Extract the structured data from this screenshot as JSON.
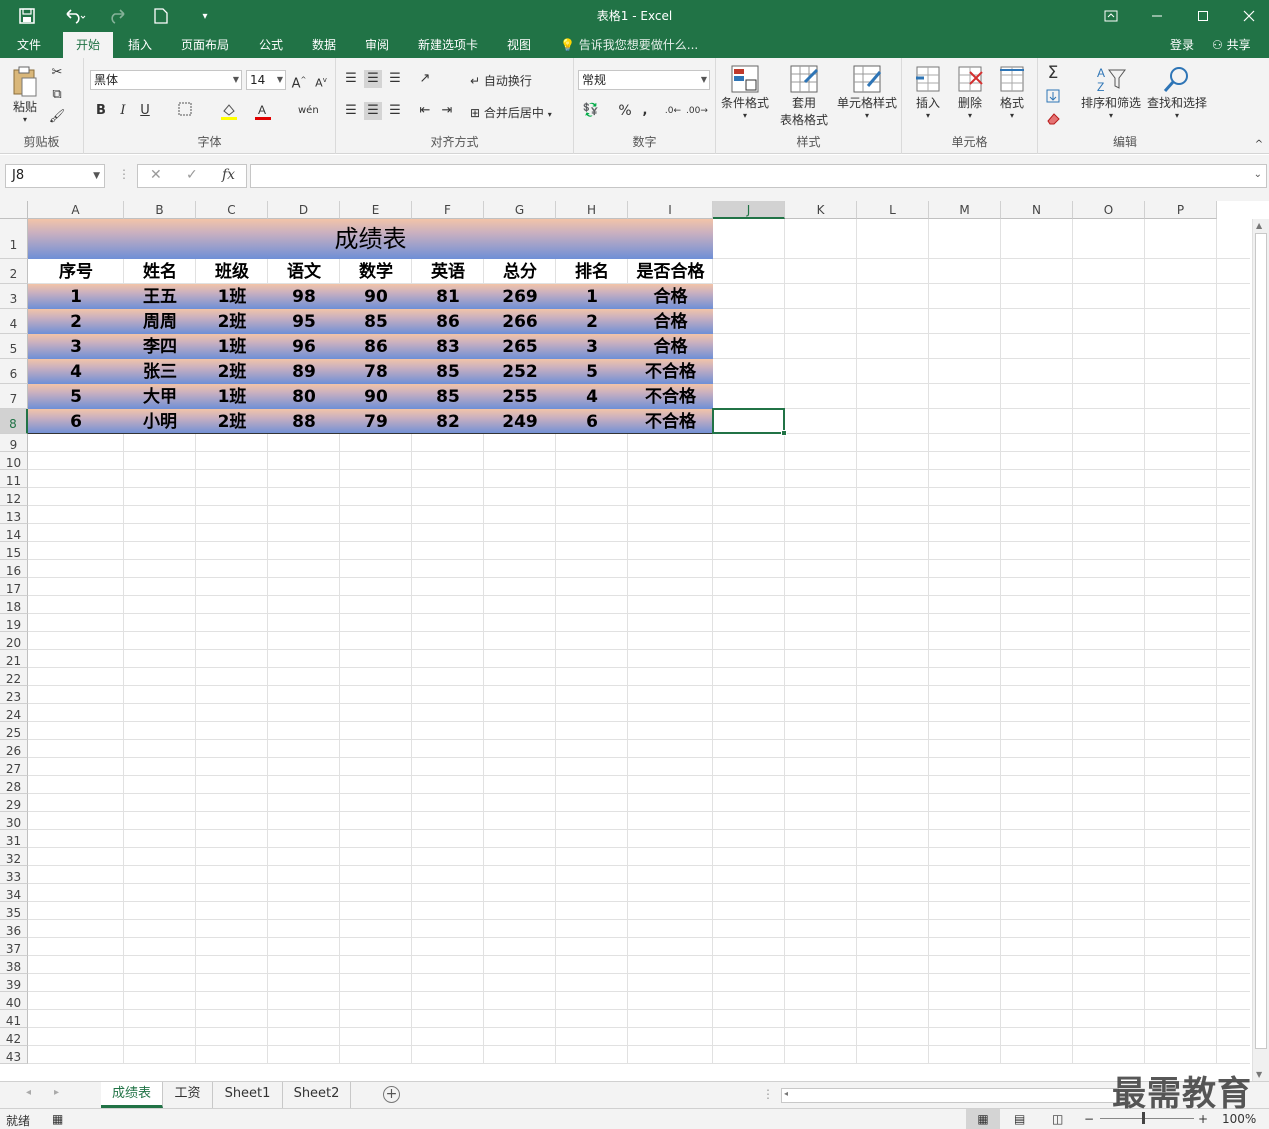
{
  "window": {
    "title": "表格1 - Excel",
    "accent": "#217346"
  },
  "quick_access": {
    "save": "save-icon",
    "undo": "undo-icon",
    "redo": "redo-icon",
    "new": "new-file-icon"
  },
  "tabs": {
    "items": [
      "文件",
      "开始",
      "插入",
      "页面布局",
      "公式",
      "数据",
      "审阅",
      "新建选项卡",
      "视图"
    ],
    "active": "开始",
    "tell_me": "告诉我您想要做什么...",
    "login": "登录",
    "share": "共享"
  },
  "ribbon": {
    "clipboard": {
      "label": "剪贴板",
      "paste": "粘贴"
    },
    "font": {
      "label": "字体",
      "name": "黑体",
      "size": "14",
      "bold": "B",
      "italic": "I",
      "underline": "U"
    },
    "alignment": {
      "label": "对齐方式",
      "wrap": "自动换行",
      "merge": "合并后居中"
    },
    "number": {
      "label": "数字",
      "format": "常规",
      "percent": "%",
      "comma": ","
    },
    "styles": {
      "label": "样式",
      "conditional": "条件格式",
      "table_format_1": "套用",
      "table_format_2": "表格格式",
      "cell_styles": "单元格样式"
    },
    "cells": {
      "label": "单元格",
      "insert": "插入",
      "delete": "删除",
      "format": "格式"
    },
    "editing": {
      "label": "编辑",
      "sort_filter": "排序和筛选",
      "find_select": "查找和选择",
      "sum": "Σ"
    }
  },
  "formula_bar": {
    "name_box": "J8",
    "fx": "fx",
    "formula": ""
  },
  "columns": [
    "A",
    "B",
    "C",
    "D",
    "E",
    "F",
    "G",
    "H",
    "I",
    "J",
    "K",
    "L",
    "M",
    "N",
    "O",
    "P"
  ],
  "rows": [
    "1",
    "2",
    "3",
    "4",
    "5",
    "6",
    "7",
    "8",
    "9",
    "10",
    "11",
    "12",
    "13",
    "14",
    "15",
    "16",
    "17",
    "18",
    "19",
    "20",
    "21",
    "22",
    "23",
    "24",
    "25",
    "26",
    "27",
    "28",
    "29",
    "30",
    "31",
    "32",
    "33",
    "34",
    "35",
    "36",
    "37",
    "38",
    "39",
    "40",
    "41",
    "42",
    "43"
  ],
  "sheet": {
    "title": "成绩表",
    "headers": [
      "序号",
      "姓名",
      "班级",
      "语文",
      "数学",
      "英语",
      "总分",
      "排名",
      "是否合格"
    ],
    "records": [
      [
        "1",
        "王五",
        "1班",
        "98",
        "90",
        "81",
        "269",
        "1",
        "合格"
      ],
      [
        "2",
        "周周",
        "2班",
        "95",
        "85",
        "86",
        "266",
        "2",
        "合格"
      ],
      [
        "3",
        "李四",
        "1班",
        "96",
        "86",
        "83",
        "265",
        "3",
        "合格"
      ],
      [
        "4",
        "张三",
        "2班",
        "89",
        "78",
        "85",
        "252",
        "5",
        "不合格"
      ],
      [
        "5",
        "大甲",
        "1班",
        "80",
        "90",
        "85",
        "255",
        "4",
        "不合格"
      ],
      [
        "6",
        "小明",
        "2班",
        "88",
        "79",
        "82",
        "249",
        "6",
        "不合格"
      ]
    ],
    "gradient_colors": [
      "#f2c4a8",
      "#6e8fd6"
    ]
  },
  "sheet_tabs": {
    "items": [
      "成绩表",
      "工资",
      "Sheet1",
      "Sheet2"
    ],
    "active": "成绩表"
  },
  "status_bar": {
    "ready": "就绪",
    "zoom": "100%"
  },
  "watermark": "最需教育"
}
